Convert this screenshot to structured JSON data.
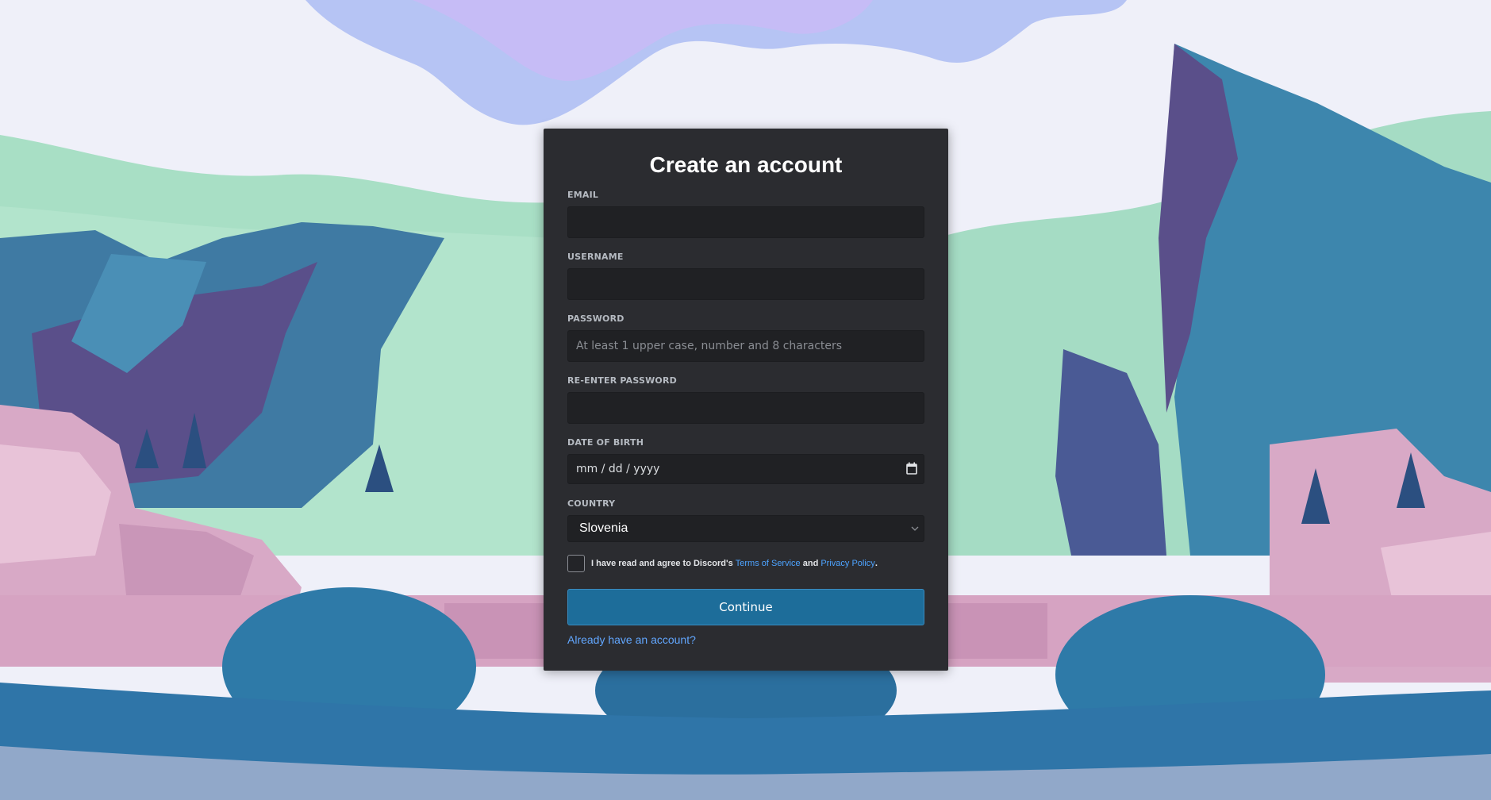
{
  "page": {
    "title": "Create an account"
  },
  "form": {
    "email": {
      "label": "EMAIL",
      "value": "",
      "placeholder": ""
    },
    "username": {
      "label": "USERNAME",
      "value": "",
      "placeholder": ""
    },
    "password": {
      "label": "PASSWORD",
      "value": "",
      "placeholder": "At least 1 upper case, number and 8 characters"
    },
    "reenter_password": {
      "label": "RE-ENTER PASSWORD",
      "value": "",
      "placeholder": ""
    },
    "date_of_birth": {
      "label": "DATE OF BIRTH",
      "placeholder": "mm / dd / yyyy"
    },
    "country": {
      "label": "COUNTRY",
      "selected": "Slovenia"
    },
    "terms": {
      "checked": false,
      "prefix": "I have read and agree to Discord's ",
      "tos_link": "Terms of Service",
      "and": " and ",
      "privacy_link": "Privacy Policy",
      "suffix": "."
    },
    "continue_label": "Continue",
    "login_link": "Already have an account?"
  },
  "icons": {
    "date_picker": "calendar-icon",
    "country_dropdown": "chevron-down-icon"
  },
  "colors": {
    "card_background": "#2b2c30",
    "input_background": "#202124",
    "primary_button": "#1d6d9a",
    "link": "#4da3ff"
  }
}
